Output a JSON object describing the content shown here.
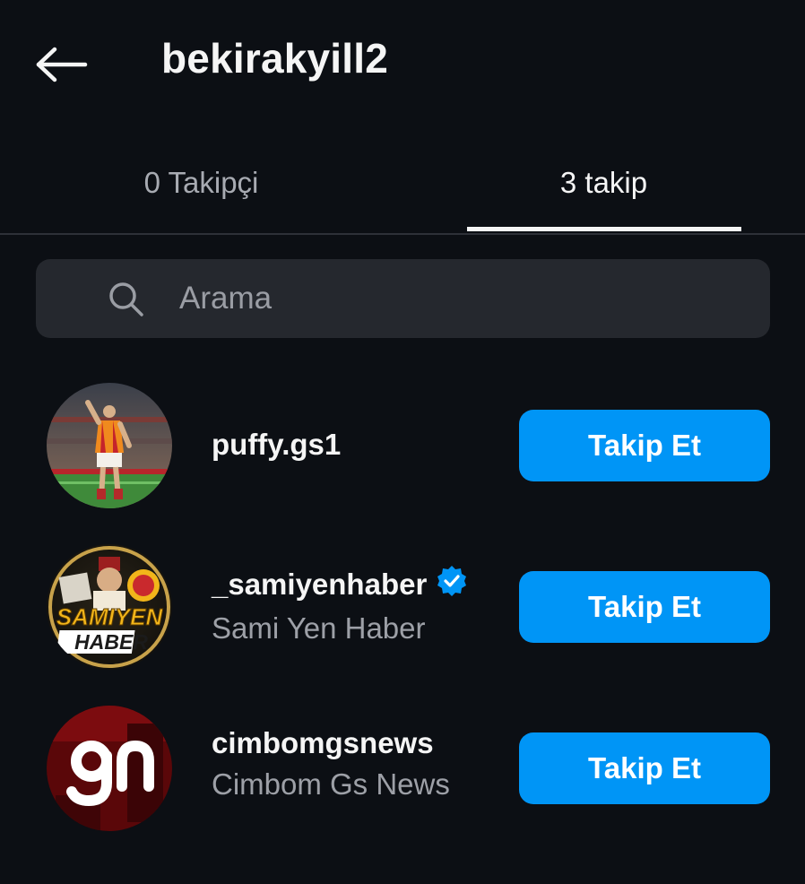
{
  "header": {
    "title": "bekirakyill2",
    "back_icon": "arrow-left-icon"
  },
  "tabs": [
    {
      "label": "0 Takipçi",
      "active": false
    },
    {
      "label": "3 takip",
      "active": true
    }
  ],
  "search": {
    "placeholder": "Arama",
    "value": "",
    "icon": "search-icon"
  },
  "colors": {
    "background": "#0c0f14",
    "accent": "#0095f6",
    "search_bg": "#25282e",
    "muted_text": "#9da0a7"
  },
  "accounts": [
    {
      "username": "puffy.gs1",
      "full_name": "",
      "verified": false,
      "button_label": "Takip Et",
      "avatar": "football-player-avatar"
    },
    {
      "username": "_samiyenhaber",
      "full_name": "Sami Yen Haber",
      "verified": true,
      "button_label": "Takip Et",
      "avatar": "samiyen-haber-logo-avatar",
      "avatar_text": [
        "SAMIYEN",
        "HABER"
      ]
    },
    {
      "username": "cimbomgsnews",
      "full_name": "Cimbom Gs News",
      "verified": false,
      "button_label": "Takip Et",
      "avatar": "gn-logo-avatar"
    }
  ]
}
